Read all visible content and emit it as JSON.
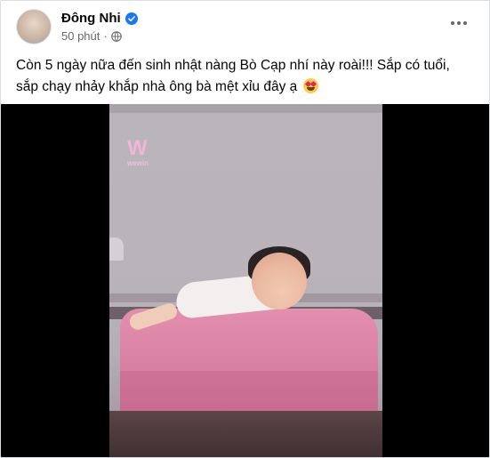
{
  "post": {
    "author": "Đông Nhi",
    "timestamp": "50 phút",
    "privacy_icon": "globe-icon",
    "verified_icon": "verified-badge-icon",
    "more_icon": "more-options-icon",
    "text_line_1": "Còn 5 ngày nữa đến sinh nhật nàng Bò Cạp nhí này roài!!! Sắp có tuổi,",
    "text_line_2": "sắp chạy nhảy khắp nhà ông bà mệt xỉu đây ạ",
    "emoji": "smiling-face-with-heart-eyes-icon"
  },
  "video": {
    "watermark": "W",
    "watermark_sub": "wewin"
  },
  "colors": {
    "verified": "#1877f2",
    "meta_text": "#65676b",
    "name_text": "#050505",
    "video_bg": "#000000",
    "blanket": "#dc84a6"
  }
}
